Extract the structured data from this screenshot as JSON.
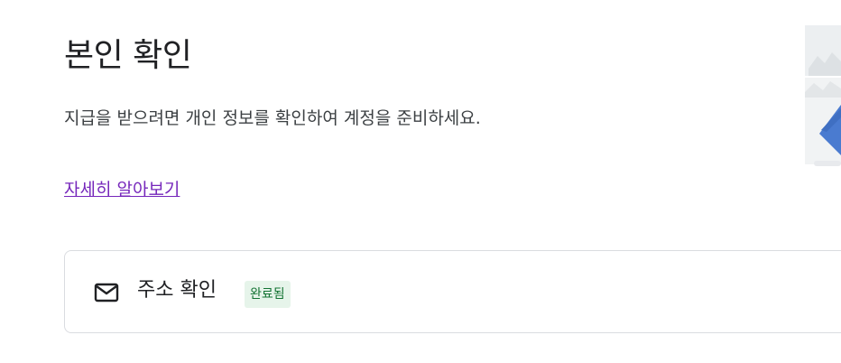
{
  "header": {
    "title": "본인 확인"
  },
  "main": {
    "description": "지급을 받으려면 개인 정보를 확인하여 계정을 준비하세요.",
    "learn_more_label": "자세히 알아보기"
  },
  "cards": [
    {
      "icon": "mail-icon",
      "label": "주소 확인",
      "status_badge": "완료됨"
    }
  ],
  "colors": {
    "link": "#7627bb",
    "badge_text": "#137333",
    "badge_bg": "#e6f4ea",
    "illustration_accent": "#4a7bd0"
  }
}
